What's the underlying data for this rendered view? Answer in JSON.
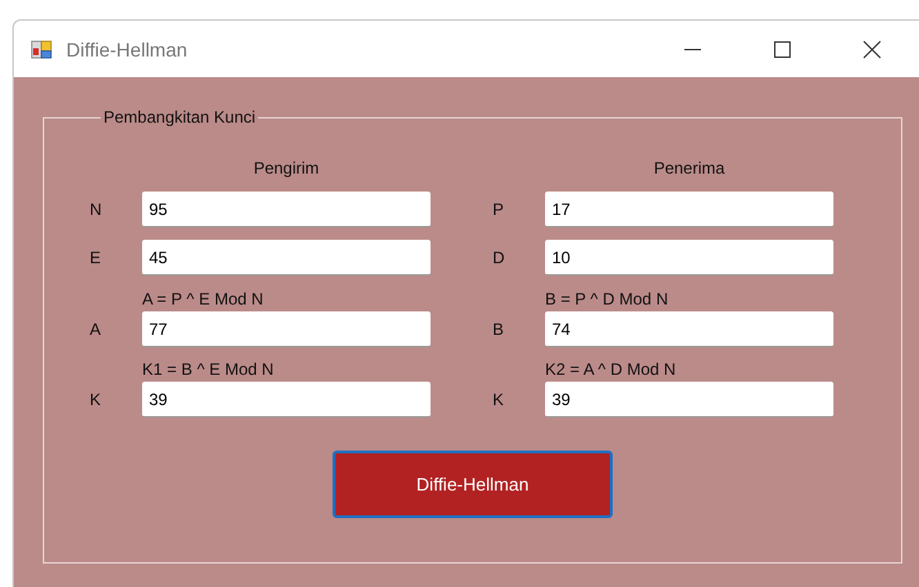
{
  "window": {
    "title": "Diffie-Hellman"
  },
  "group": {
    "title": "Pembangkitan Kunci",
    "columns": [
      {
        "header": "Pengirim",
        "rows": [
          {
            "label": "N",
            "value": "95"
          },
          {
            "label": "E",
            "value": "45"
          },
          {
            "label": "A",
            "caption": "A = P ^ E Mod N",
            "value": "77"
          },
          {
            "label": "K",
            "caption": "K1 = B ^ E Mod N",
            "value": "39"
          }
        ]
      },
      {
        "header": "Penerima",
        "rows": [
          {
            "label": "P",
            "value": "17"
          },
          {
            "label": "D",
            "value": "10"
          },
          {
            "label": "B",
            "caption": "B = P ^ D Mod N",
            "value": "74"
          },
          {
            "label": "K",
            "caption": "K2 = A ^ D Mod N",
            "value": "39"
          }
        ]
      }
    ]
  },
  "button": {
    "label": "Diffie-Hellman"
  }
}
